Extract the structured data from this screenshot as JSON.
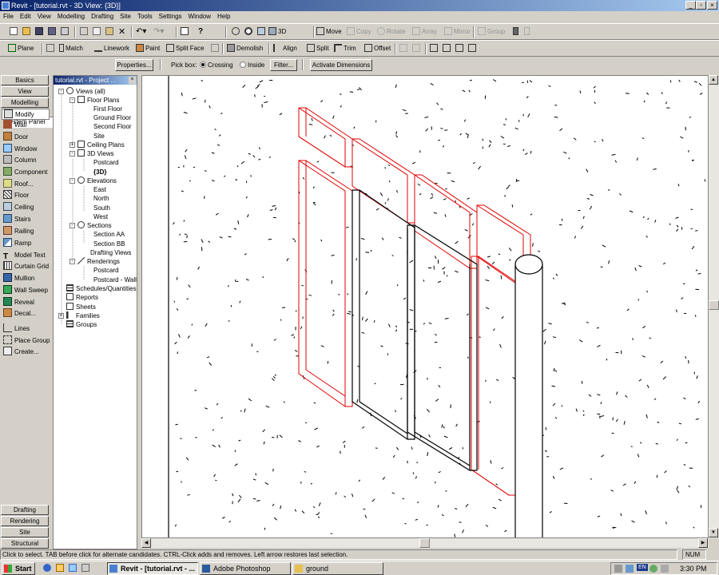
{
  "window": {
    "title": "Revit - [tutorial.rvt - 3D View: {3D}]"
  },
  "menu": [
    "File",
    "Edit",
    "View",
    "Modelling",
    "Drafting",
    "Site",
    "Tools",
    "Settings",
    "Window",
    "Help"
  ],
  "toolbar1": {
    "view_3d": "3D",
    "move": "Move",
    "copy": "Copy",
    "rotate": "Rotate",
    "array": "Array",
    "mirror": "Mirror",
    "group": "Group"
  },
  "toolbar2": {
    "plane": "Plane",
    "match": "Match",
    "linework": "Linework",
    "paint": "Paint",
    "split_face": "Split Face",
    "demolish": "Demolish",
    "align": "Align",
    "split": "Split",
    "trim": "Trim",
    "offset": "Offset"
  },
  "options": {
    "type_selector": "System Panel",
    "properties": "Properties...",
    "pick_box": "Pick box:",
    "crossing": "Crossing",
    "inside": "Inside",
    "filter": "Filter...",
    "activate_dimensions": "Activate Dimensions"
  },
  "design_bar": {
    "tabs_top": [
      "Basics",
      "View",
      "Modelling"
    ],
    "tools": [
      "Modify",
      "Wall",
      "Door",
      "Window",
      "Column",
      "Component",
      "Roof...",
      "Floor",
      "Ceiling",
      "Stairs",
      "Railing",
      "Ramp",
      "Model Text",
      "Curtain Grid",
      "Mullion",
      "Wall Sweep",
      "Reveal",
      "Decal...",
      "Lines",
      "Place Group",
      "Create..."
    ],
    "tabs_bottom": [
      "Drafting",
      "Rendering",
      "Site",
      "Structural"
    ]
  },
  "browser": {
    "title": "tutorial.rvt - Project ...",
    "close": "×",
    "nodes": [
      "Views (all)",
      "Floor Plans",
      "First Floor",
      "Ground Floor",
      "Second Floor",
      "Site",
      "Ceiling Plans",
      "3D Views",
      "Postcard",
      "{3D}",
      "Elevations",
      "East",
      "North",
      "South",
      "West",
      "Sections",
      "Section AA",
      "Section BB",
      "Drafting Views",
      "Renderings",
      "Postcard",
      "Postcard - Wall",
      "Schedules/Quantities",
      "Reports",
      "Sheets",
      "Families",
      "Groups"
    ]
  },
  "status": {
    "message": "Click to select. TAB before click for alternate candidates. CTRL-Click adds and removes. Left arrow restores last selection.",
    "num": "NUM"
  },
  "taskbar": {
    "start": "Start",
    "tasks": [
      "Revit - [tutorial.rvt - ...",
      "Adobe Photoshop",
      "ground"
    ],
    "lang": "EN",
    "clock": "3:30 PM"
  },
  "icons": [
    "new-icon",
    "open-icon",
    "save-icon",
    "print-icon",
    "cut-icon",
    "copy-icon",
    "paste-icon",
    "delete-icon",
    "undo-icon",
    "redo-icon",
    "help-icon",
    "zoom-icon",
    "3d-view-icon",
    "pin-icon"
  ],
  "colors": {
    "selection_red": "#e00000",
    "title_blue": "#0a246a",
    "face": "#d4d0c8"
  }
}
